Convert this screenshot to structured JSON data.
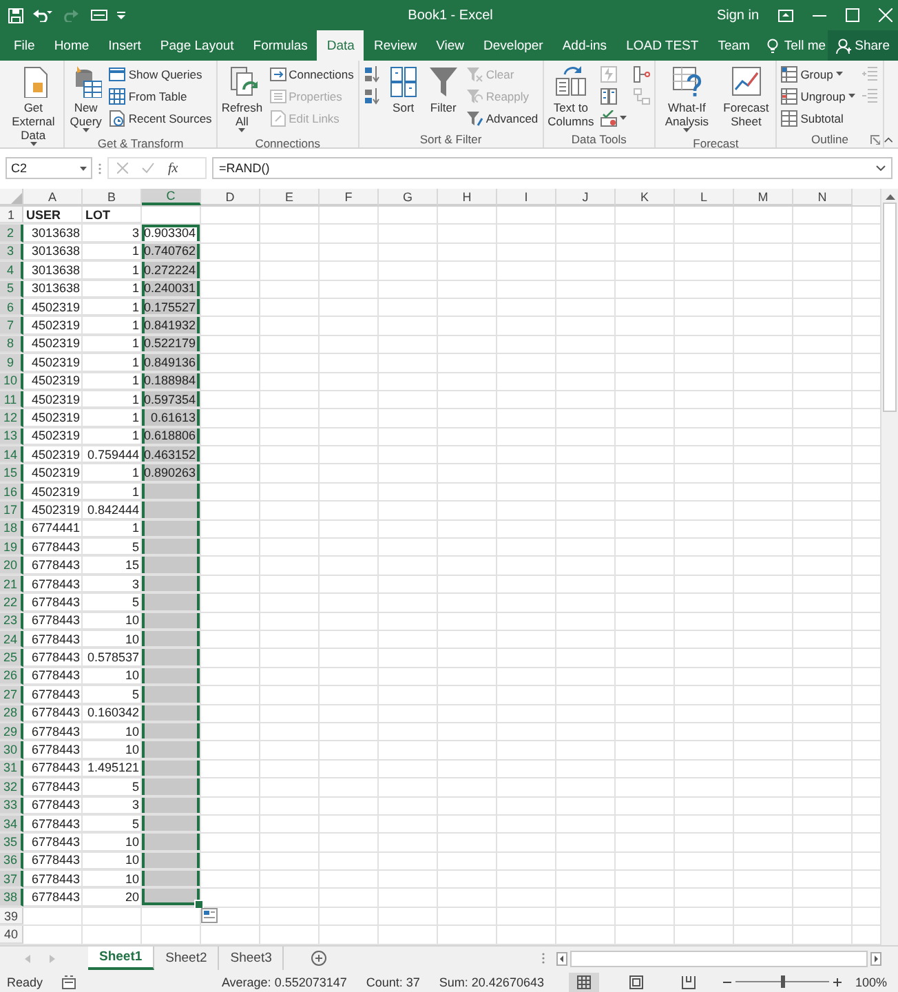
{
  "title_bar": {
    "title": "Book1 - Excel",
    "sign_in": "Sign in"
  },
  "tabs": [
    {
      "label": "File",
      "selected": false
    },
    {
      "label": "Home",
      "selected": false
    },
    {
      "label": "Insert",
      "selected": false
    },
    {
      "label": "Page Layout",
      "selected": false
    },
    {
      "label": "Formulas",
      "selected": false
    },
    {
      "label": "Data",
      "selected": true
    },
    {
      "label": "Review",
      "selected": false
    },
    {
      "label": "View",
      "selected": false
    },
    {
      "label": "Developer",
      "selected": false
    },
    {
      "label": "Add-ins",
      "selected": false
    },
    {
      "label": "LOAD TEST",
      "selected": false
    },
    {
      "label": "Team",
      "selected": false
    }
  ],
  "tell_me": "Tell me",
  "share": "Share",
  "ribbon": [
    {
      "commands": [
        {
          "label": "Get External Data",
          "kind": "large",
          "dropdown": true,
          "disabled": false
        }
      ]
    },
    {
      "label": "Get & Transform",
      "commands": [
        {
          "label": "New Query",
          "kind": "large",
          "dropdown": true,
          "disabled": false
        },
        {
          "label": "Show Queries",
          "kind": "small",
          "disabled": false
        },
        {
          "label": "From Table",
          "kind": "small",
          "disabled": false
        },
        {
          "label": "Recent Sources",
          "kind": "small",
          "disabled": false
        }
      ]
    },
    {
      "label": "Connections",
      "commands": [
        {
          "label": "Refresh All",
          "kind": "large",
          "dropdown": true,
          "disabled": false
        },
        {
          "label": "Connections",
          "kind": "small",
          "disabled": false
        },
        {
          "label": "Properties",
          "kind": "small",
          "disabled": true
        },
        {
          "label": "Edit Links",
          "kind": "small",
          "disabled": true
        }
      ]
    },
    {
      "label": "Sort & Filter",
      "commands": [
        {
          "kind": "icon",
          "disabled": false
        },
        {
          "kind": "icon",
          "disabled": false
        },
        {
          "label": "Sort",
          "kind": "large",
          "disabled": false
        },
        {
          "label": "Filter",
          "kind": "large",
          "disabled": false
        },
        {
          "label": "Clear",
          "kind": "small",
          "disabled": true
        },
        {
          "label": "Reapply",
          "kind": "small",
          "disabled": true
        },
        {
          "label": "Advanced",
          "kind": "small",
          "disabled": false
        }
      ]
    },
    {
      "label": "Data Tools",
      "commands": [
        {
          "label": "Text to Columns",
          "kind": "large",
          "disabled": false
        },
        {
          "kind": "icon",
          "disabled": true
        },
        {
          "kind": "icon",
          "disabled": false
        },
        {
          "kind": "icon",
          "dropdown": true,
          "disabled": false
        },
        {
          "kind": "icon",
          "disabled": false
        },
        {
          "kind": "icon",
          "disabled": true
        }
      ]
    },
    {
      "label": "Forecast",
      "commands": [
        {
          "label": "What-If Analysis",
          "kind": "large",
          "dropdown": true,
          "disabled": false
        },
        {
          "label": "Forecast Sheet",
          "kind": "large",
          "disabled": false
        }
      ]
    },
    {
      "label": "Outline",
      "launcher": true,
      "commands": [
        {
          "label": "Group",
          "kind": "small",
          "dropdown": true,
          "disabled": false
        },
        {
          "label": "Ungroup",
          "kind": "small",
          "dropdown": true,
          "disabled": false
        },
        {
          "label": "Subtotal",
          "kind": "small",
          "disabled": false
        },
        {
          "kind": "icon",
          "disabled": true
        },
        {
          "kind": "icon",
          "disabled": true
        }
      ]
    }
  ],
  "formula_bar": {
    "name_box": "C2",
    "insert_function": "fx",
    "formula": "=RAND()"
  },
  "columns": [
    {
      "label": "A",
      "selected": false
    },
    {
      "label": "B",
      "selected": false
    },
    {
      "label": "C",
      "selected": true
    },
    {
      "label": "D",
      "selected": false
    },
    {
      "label": "E",
      "selected": false
    },
    {
      "label": "F",
      "selected": false
    },
    {
      "label": "G",
      "selected": false
    },
    {
      "label": "H",
      "selected": false
    },
    {
      "label": "I",
      "selected": false
    },
    {
      "label": "J",
      "selected": false
    },
    {
      "label": "K",
      "selected": false
    },
    {
      "label": "L",
      "selected": false
    },
    {
      "label": "M",
      "selected": false
    },
    {
      "label": "N",
      "selected": false
    }
  ],
  "rows": [
    {
      "number": "1",
      "kind": "header",
      "selected": false,
      "active": false,
      "cells": [
        "USER",
        "LOT"
      ]
    },
    {
      "number": "2",
      "kind": "data",
      "selected": true,
      "active": true,
      "cells": [
        "3013638",
        "3",
        "0.903304"
      ]
    },
    {
      "number": "3",
      "kind": "data",
      "selected": true,
      "active": false,
      "cells": [
        "3013638",
        "1",
        "0.740762"
      ]
    },
    {
      "number": "4",
      "kind": "data",
      "selected": true,
      "active": false,
      "cells": [
        "3013638",
        "1",
        "0.272224"
      ]
    },
    {
      "number": "5",
      "kind": "data",
      "selected": true,
      "active": false,
      "cells": [
        "3013638",
        "1",
        "0.240031"
      ]
    },
    {
      "number": "6",
      "kind": "data",
      "selected": true,
      "active": false,
      "cells": [
        "4502319",
        "1",
        "0.175527"
      ]
    },
    {
      "number": "7",
      "kind": "data",
      "selected": true,
      "active": false,
      "cells": [
        "4502319",
        "1",
        "0.841932"
      ]
    },
    {
      "number": "8",
      "kind": "data",
      "selected": true,
      "active": false,
      "cells": [
        "4502319",
        "1",
        "0.522179"
      ]
    },
    {
      "number": "9",
      "kind": "data",
      "selected": true,
      "active": false,
      "cells": [
        "4502319",
        "1",
        "0.849136"
      ]
    },
    {
      "number": "10",
      "kind": "data",
      "selected": true,
      "active": false,
      "cells": [
        "4502319",
        "1",
        "0.188984"
      ]
    },
    {
      "number": "11",
      "kind": "data",
      "selected": true,
      "active": false,
      "cells": [
        "4502319",
        "1",
        "0.597354"
      ]
    },
    {
      "number": "12",
      "kind": "data",
      "selected": true,
      "active": false,
      "cells": [
        "4502319",
        "1",
        "0.61613"
      ]
    },
    {
      "number": "13",
      "kind": "data",
      "selected": true,
      "active": false,
      "cells": [
        "4502319",
        "1",
        "0.618806"
      ]
    },
    {
      "number": "14",
      "kind": "data",
      "selected": true,
      "active": false,
      "cells": [
        "4502319",
        "0.759444",
        "0.463152"
      ]
    },
    {
      "number": "15",
      "kind": "data",
      "selected": true,
      "active": false,
      "cells": [
        "4502319",
        "1",
        "0.890263"
      ]
    },
    {
      "number": "16",
      "kind": "data",
      "selected": true,
      "active": false,
      "cells": [
        "4502319",
        "1"
      ]
    },
    {
      "number": "17",
      "kind": "data",
      "selected": true,
      "active": false,
      "cells": [
        "4502319",
        "0.842444"
      ]
    },
    {
      "number": "18",
      "kind": "data",
      "selected": true,
      "active": false,
      "cells": [
        "6774441",
        "1"
      ]
    },
    {
      "number": "19",
      "kind": "data",
      "selected": true,
      "active": false,
      "cells": [
        "6778443",
        "5"
      ]
    },
    {
      "number": "20",
      "kind": "data",
      "selected": true,
      "active": false,
      "cells": [
        "6778443",
        "15"
      ]
    },
    {
      "number": "21",
      "kind": "data",
      "selected": true,
      "active": false,
      "cells": [
        "6778443",
        "3"
      ]
    },
    {
      "number": "22",
      "kind": "data",
      "selected": true,
      "active": false,
      "cells": [
        "6778443",
        "5"
      ]
    },
    {
      "number": "23",
      "kind": "data",
      "selected": true,
      "active": false,
      "cells": [
        "6778443",
        "10"
      ]
    },
    {
      "number": "24",
      "kind": "data",
      "selected": true,
      "active": false,
      "cells": [
        "6778443",
        "10"
      ]
    },
    {
      "number": "25",
      "kind": "data",
      "selected": true,
      "active": false,
      "cells": [
        "6778443",
        "0.578537"
      ]
    },
    {
      "number": "26",
      "kind": "data",
      "selected": true,
      "active": false,
      "cells": [
        "6778443",
        "10"
      ]
    },
    {
      "number": "27",
      "kind": "data",
      "selected": true,
      "active": false,
      "cells": [
        "6778443",
        "5"
      ]
    },
    {
      "number": "28",
      "kind": "data",
      "selected": true,
      "active": false,
      "cells": [
        "6778443",
        "0.160342"
      ]
    },
    {
      "number": "29",
      "kind": "data",
      "selected": true,
      "active": false,
      "cells": [
        "6778443",
        "10"
      ]
    },
    {
      "number": "30",
      "kind": "data",
      "selected": true,
      "active": false,
      "cells": [
        "6778443",
        "10"
      ]
    },
    {
      "number": "31",
      "kind": "data",
      "selected": true,
      "active": false,
      "cells": [
        "6778443",
        "1.495121"
      ]
    },
    {
      "number": "32",
      "kind": "data",
      "selected": true,
      "active": false,
      "cells": [
        "6778443",
        "5"
      ]
    },
    {
      "number": "33",
      "kind": "data",
      "selected": true,
      "active": false,
      "cells": [
        "6778443",
        "3"
      ]
    },
    {
      "number": "34",
      "kind": "data",
      "selected": true,
      "active": false,
      "cells": [
        "6778443",
        "5"
      ]
    },
    {
      "number": "35",
      "kind": "data",
      "selected": true,
      "active": false,
      "cells": [
        "6778443",
        "10"
      ]
    },
    {
      "number": "36",
      "kind": "data",
      "selected": true,
      "active": false,
      "cells": [
        "6778443",
        "10"
      ]
    },
    {
      "number": "37",
      "kind": "data",
      "selected": true,
      "active": false,
      "cells": [
        "6778443",
        "10"
      ]
    },
    {
      "number": "38",
      "kind": "data",
      "selected": true,
      "active": false,
      "cells": [
        "6778443",
        "20"
      ]
    },
    {
      "number": "39",
      "kind": "data",
      "selected": false,
      "active": false
    },
    {
      "number": "40",
      "kind": "data",
      "selected": false,
      "active": false
    }
  ],
  "sheets": [
    {
      "label": "Sheet1",
      "selected": true
    },
    {
      "label": "Sheet2",
      "selected": false
    },
    {
      "label": "Sheet3",
      "selected": false
    }
  ],
  "status_bar": {
    "mode": "Ready",
    "average": "Average: 0.552073147",
    "count": "Count: 37",
    "sum": "Sum: 20.42670643",
    "zoom": "100%",
    "zoom_slider": {
      "level": 0.5
    }
  }
}
